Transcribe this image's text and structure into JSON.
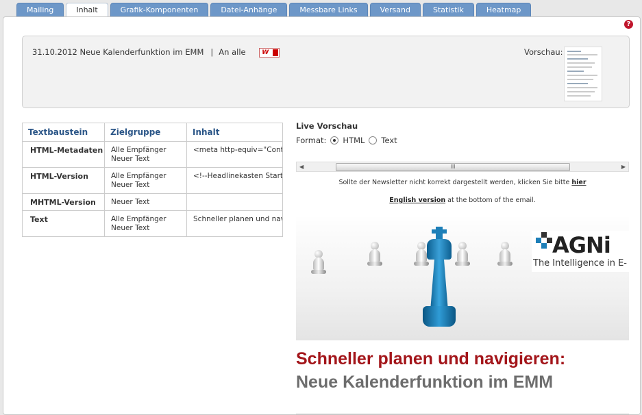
{
  "tabs": [
    {
      "label": "Mailing"
    },
    {
      "label": "Inhalt"
    },
    {
      "label": "Grafik-Komponenten"
    },
    {
      "label": "Datei-Anhänge"
    },
    {
      "label": "Messbare Links"
    },
    {
      "label": "Versand"
    },
    {
      "label": "Statistik"
    },
    {
      "label": "Heatmap"
    }
  ],
  "active_tab": "Inhalt",
  "help_icon": "?",
  "mailing": {
    "title": "31.10.2012 Neue Kalenderfunktion im EMM",
    "separator": "|",
    "recipients": "An alle",
    "word_icon": "W",
    "preview_label": "Vorschau:"
  },
  "table": {
    "headers": [
      "Textbaustein",
      "Zielgruppe",
      "Inhalt"
    ],
    "rows": [
      {
        "name": "HTML-Metadaten",
        "target1": "Alle Empfänger",
        "target2": "Neuer Text",
        "content": "<meta http-equiv=\"Conten"
      },
      {
        "name": "HTML-Version",
        "target1": "Alle Empfänger",
        "target2": "Neuer Text",
        "content": "<!--Headlinekasten Start --"
      },
      {
        "name": "MHTML-Version",
        "target1": "Neuer Text",
        "target2": "",
        "content": ""
      },
      {
        "name": "Text",
        "target1": "Alle Empfänger",
        "target2": "Neuer Text",
        "content": "Schneller planen und navigi"
      }
    ]
  },
  "live_preview": {
    "title": "Live Vorschau",
    "format_label": "Format:",
    "options": [
      "HTML",
      "Text"
    ],
    "selected": "HTML",
    "scroll_grip": "III"
  },
  "newsletter": {
    "line1_text": "Sollte der Newsletter nicht korrekt dargestellt werden, klicken Sie bitte ",
    "line1_link": "hier",
    "line2_link": "English version",
    "line2_text": " at the bottom of the email.",
    "logo_text": "AGNi",
    "logo_subtitle": "The Intelligence in E-",
    "headline1": "Schneller planen und navigieren:",
    "headline2": "Neue Kalenderfunktion im EMM"
  },
  "colors": {
    "tab_blue": "#6d97c8",
    "header_blue": "#2a5587",
    "headline_red": "#a3151a",
    "king_blue": "#1d7fb8"
  }
}
